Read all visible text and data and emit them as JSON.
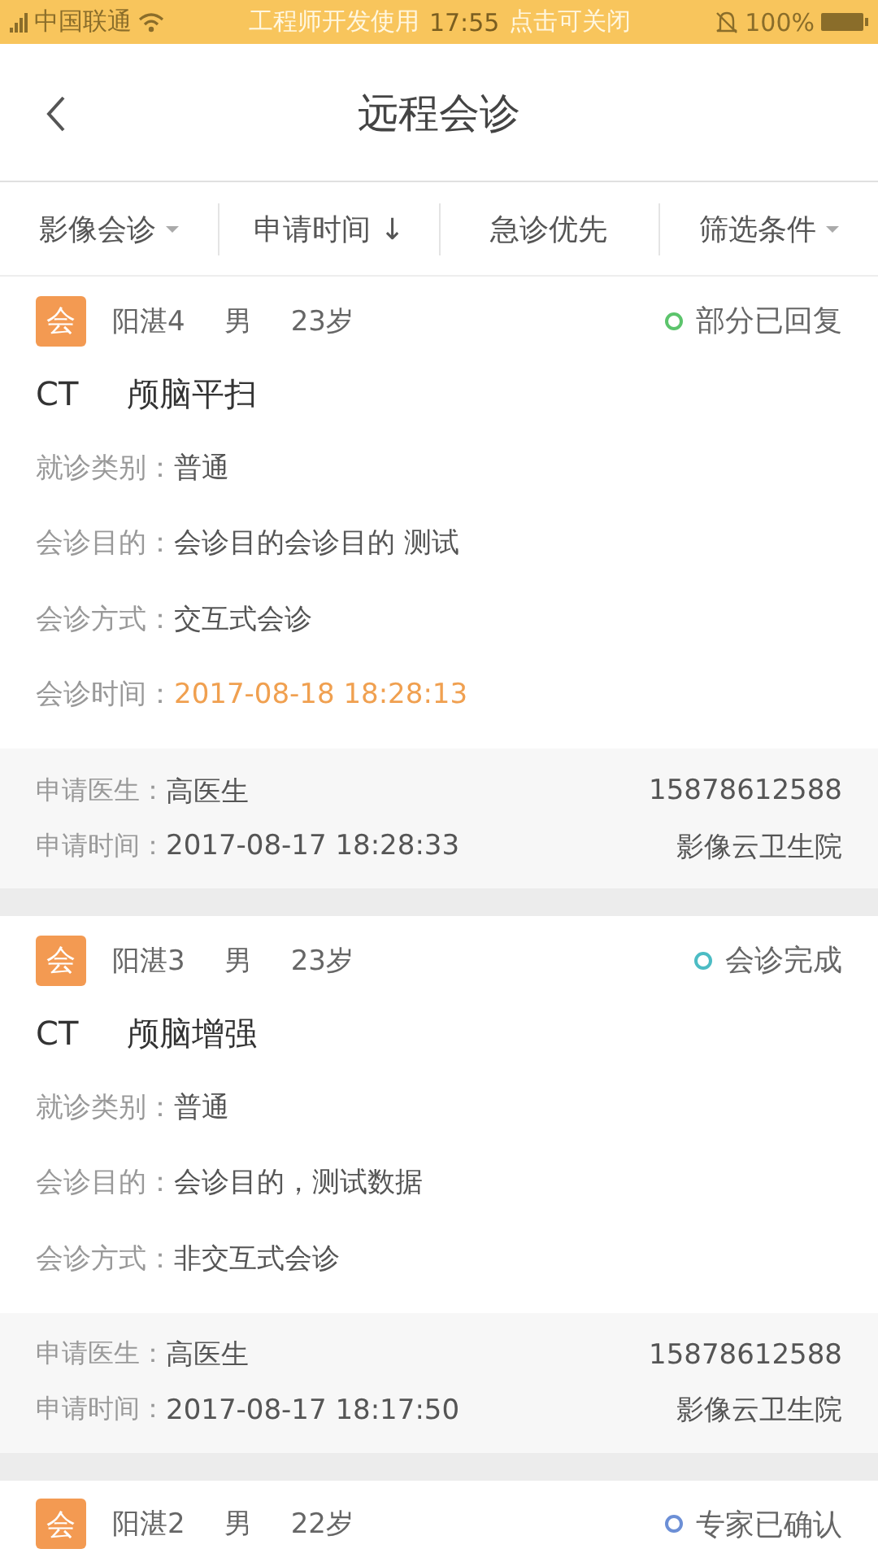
{
  "status_bar": {
    "carrier": "中国联通",
    "banner": "工程师开发使用",
    "time": "17:55",
    "banner_action": "点击可关闭",
    "battery": "100%"
  },
  "nav": {
    "title": "远程会诊"
  },
  "filters": [
    {
      "label": "影像会诊",
      "kind": "dropdown"
    },
    {
      "label": "申请时间",
      "kind": "sort",
      "arrow": "↓"
    },
    {
      "label": "急诊优先",
      "kind": "plain"
    },
    {
      "label": "筛选条件",
      "kind": "dropdown"
    }
  ],
  "cards": [
    {
      "badge": "会",
      "name": "阳湛4",
      "sex": "男",
      "age": "23岁",
      "status": "部分已回复",
      "color": "#5cc46c",
      "modality": "CT",
      "exam": "颅脑平扫",
      "fields": [
        {
          "label": "就诊类别：",
          "value": "普通",
          "highlight": false
        },
        {
          "label": "会诊目的：",
          "value": "会诊目的会诊目的 测试",
          "highlight": false
        },
        {
          "label": "会诊方式：",
          "value": "交互式会诊",
          "highlight": false
        },
        {
          "label": "会诊时间：",
          "value": "2017-08-18 18:28:13",
          "highlight": true
        }
      ],
      "doctor_label": "申请医生：",
      "doctor": "高医生",
      "phone": "15878612588",
      "time_label": "申请时间：",
      "time": "2017-08-17 18:28:33",
      "hospital": "影像云卫生院"
    },
    {
      "badge": "会",
      "name": "阳湛3",
      "sex": "男",
      "age": "23岁",
      "status": "会诊完成",
      "color": "#4cbcc4",
      "modality": "CT",
      "exam": "颅脑增强",
      "fields": [
        {
          "label": "就诊类别：",
          "value": "普通",
          "highlight": false
        },
        {
          "label": "会诊目的：",
          "value": "会诊目的，测试数据",
          "highlight": false
        },
        {
          "label": "会诊方式：",
          "value": "非交互式会诊",
          "highlight": false
        }
      ],
      "doctor_label": "申请医生：",
      "doctor": "高医生",
      "phone": "15878612588",
      "time_label": "申请时间：",
      "time": "2017-08-17 18:17:50",
      "hospital": "影像云卫生院"
    },
    {
      "badge": "会",
      "name": "阳湛2",
      "sex": "男",
      "age": "22岁",
      "status": "专家已确认",
      "color": "#6c8fd6"
    }
  ]
}
